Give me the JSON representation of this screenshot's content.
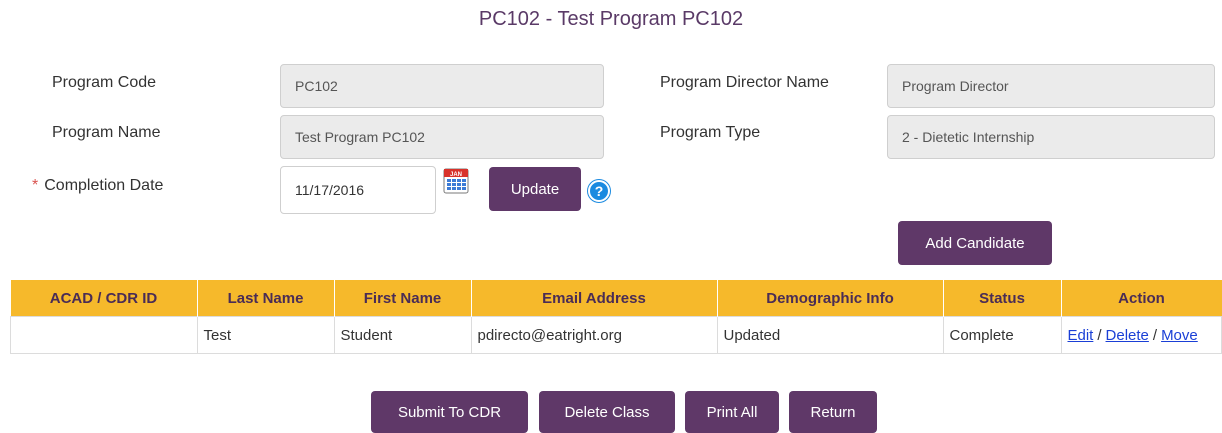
{
  "page_title": "PC102 - Test Program PC102",
  "form": {
    "program_code_label": "Program Code",
    "program_code_value": "PC102",
    "program_name_label": "Program Name",
    "program_name_value": "Test Program PC102",
    "completion_date_required": "*",
    "completion_date_label": "Completion Date",
    "completion_date_value": "11/17/2016",
    "program_director_label": "Program Director Name",
    "program_director_value": "Program Director",
    "program_type_label": "Program Type",
    "program_type_value": "2 - Dietetic Internship",
    "calendar_icon_text": "JAN"
  },
  "buttons": {
    "update": "Update",
    "help": "?",
    "add_candidate": "Add Candidate",
    "submit_to_cdr": "Submit To CDR",
    "delete_class": "Delete Class",
    "print_all": "Print All",
    "return": "Return"
  },
  "table": {
    "headers": [
      "ACAD / CDR ID",
      "Last Name",
      "First Name",
      "Email Address",
      "Demographic Info",
      "Status",
      "Action"
    ],
    "rows": [
      {
        "acad_id": "",
        "last_name": "Test",
        "first_name": "Student",
        "email": "pdirecto@eatright.org",
        "demographic": "Updated",
        "status": "Complete",
        "actions": {
          "edit": "Edit",
          "delete": "Delete",
          "move": "Move",
          "sep": "/"
        }
      }
    ]
  },
  "colors": {
    "accent_purple": "#5f3868",
    "header_gold": "#f6b92b",
    "link_blue": "#1a3fd6",
    "help_blue": "#1a8ae0"
  }
}
